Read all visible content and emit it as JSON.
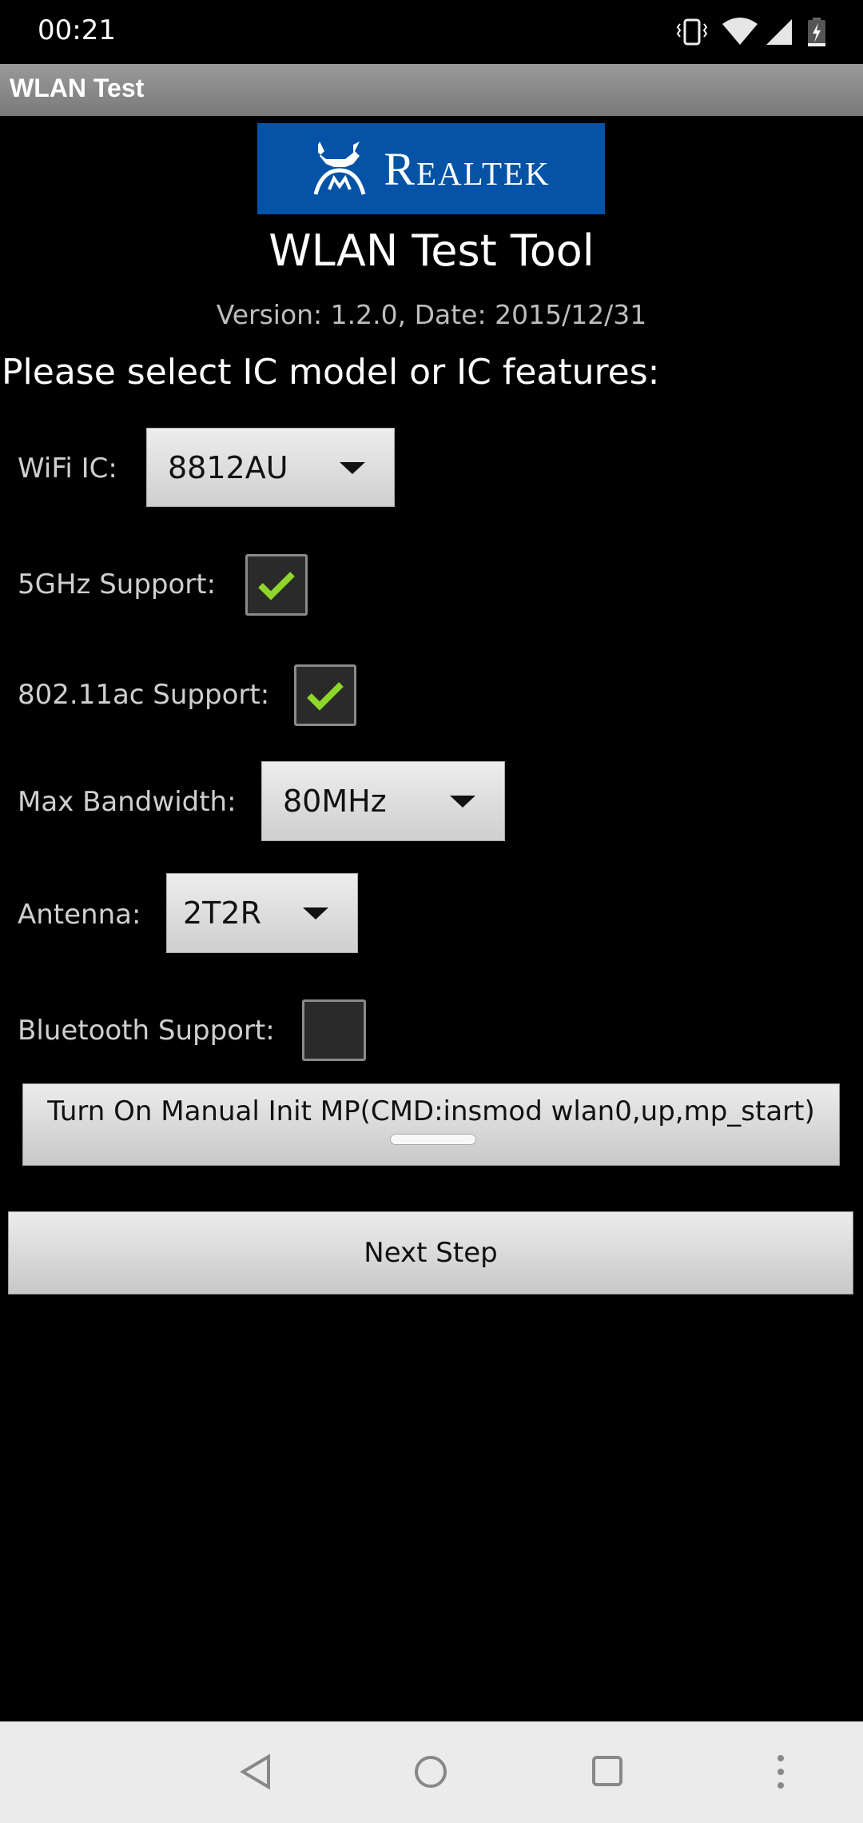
{
  "status_bar": {
    "time": "00:21",
    "icons": [
      "vibrate-icon",
      "wifi-icon",
      "cell-signal-icon",
      "battery-charging-icon"
    ]
  },
  "app_bar": {
    "title": "WLAN Test"
  },
  "logo": {
    "text": "Realtek",
    "color": "#0453a6"
  },
  "header": {
    "title": "WLAN Test Tool",
    "version": "Version: 1.2.0, Date: 2015/12/31"
  },
  "prompt": "Please select IC model or IC features:",
  "form": {
    "wifi_ic": {
      "label": "WiFi IC:",
      "value": "8812AU"
    },
    "support_5ghz": {
      "label": "5GHz Support:",
      "checked": true
    },
    "support_80211ac": {
      "label": "802.11ac Support:",
      "checked": true
    },
    "max_bandwidth": {
      "label": "Max Bandwidth:",
      "value": "80MHz"
    },
    "antenna": {
      "label": "Antenna:",
      "value": "2T2R"
    },
    "bluetooth": {
      "label": "Bluetooth Support:",
      "checked": false
    }
  },
  "buttons": {
    "manual_init": "Turn On Manual Init MP(CMD:insmod wlan0,up,mp_start)",
    "next_step": "Next Step"
  },
  "nav": [
    "back-icon",
    "home-icon",
    "recents-icon",
    "more-icon"
  ]
}
